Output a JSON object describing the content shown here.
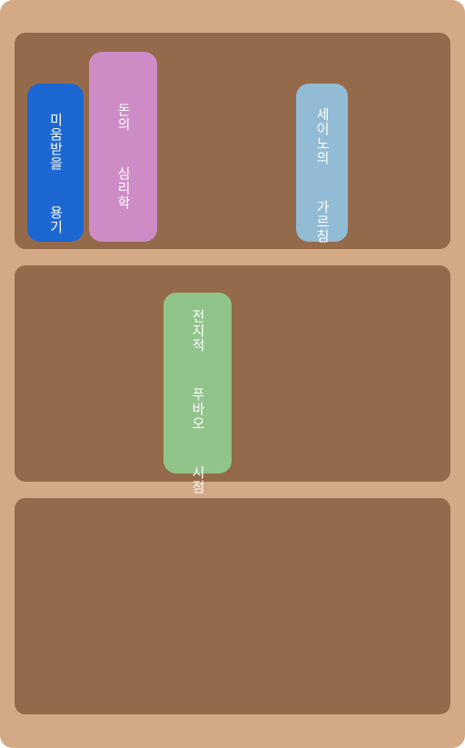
{
  "shelves": [
    {
      "books": [
        {
          "title": "미움받을  용기",
          "color": "#1c67d2"
        },
        {
          "title": "돈의  심리학",
          "color": "#ce8cc6"
        },
        {
          "title": "세이노의  가르침",
          "color": "#92bcd6"
        }
      ]
    },
    {
      "books": [
        {
          "title": "전지적  푸바오  시점",
          "color": "#91c48a"
        }
      ]
    },
    {
      "books": []
    }
  ],
  "colors": {
    "bookcase": "#d4aa86",
    "shelf": "#956a4b"
  }
}
